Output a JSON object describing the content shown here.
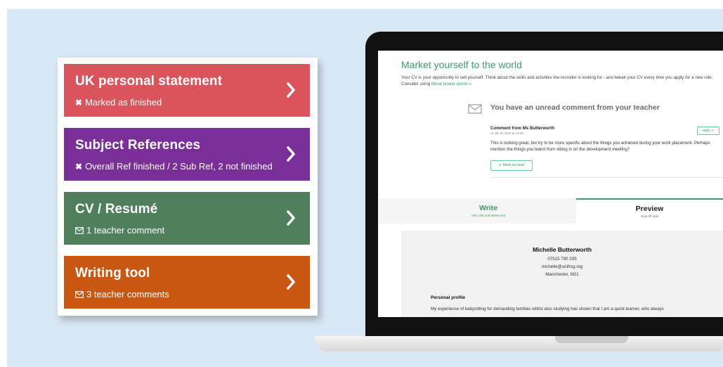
{
  "cards": [
    {
      "title": "UK personal statement",
      "subtitle": "Marked as finished",
      "icon": "x-icon",
      "color": "#d9545b"
    },
    {
      "title": "Subject References",
      "subtitle": "Overall Ref finished / 2 Sub Ref, 2 not finished",
      "icon": "x-icon",
      "color": "#7a2e97"
    },
    {
      "title": "CV / Resumé",
      "subtitle": "1 teacher comment",
      "icon": "mail-icon",
      "color": "#4f7f5c"
    },
    {
      "title": "Writing tool",
      "subtitle": "3 teacher comments",
      "icon": "mail-icon",
      "color": "#c95712"
    }
  ],
  "screen": {
    "title": "Market yourself to the world",
    "intro": "Your CV is your opportunity to sell yourself. Think about the skills and activities the recruiter is looking for - and tweak your CV every time you apply for a new role. Consider using",
    "intro_link": "these power words »",
    "notice": "You have an unread comment from your teacher",
    "comment": {
      "from": "Comment from Ms Butterworth",
      "date": "on 25 Jul 2022 at 15:58",
      "body": "This is looking great, but try to be more specific about the things you achieved during your work placement. Perhaps mention the things you learnt from sitting in on the development meeting?",
      "reply_label": "reply ↩",
      "mark_label": "✔ Mark as read"
    },
    "tabs": {
      "write": {
        "label": "Write",
        "sub": "Add, edit and delete text"
      },
      "preview": {
        "label": "Preview",
        "sub": "How it'll look"
      }
    },
    "cv": {
      "name": "Michelle Butterworth",
      "phone": "07515 790 295",
      "email": "michelle@unifrog.org",
      "location": "Manchester, M21",
      "section": "Personal profile",
      "profile": "My experience of babysitting for demanding families whilst also studying has shown that I am a quick learner, who always"
    }
  },
  "colors": {
    "accent": "#3d9a6a",
    "background": "#d9e8f5"
  }
}
